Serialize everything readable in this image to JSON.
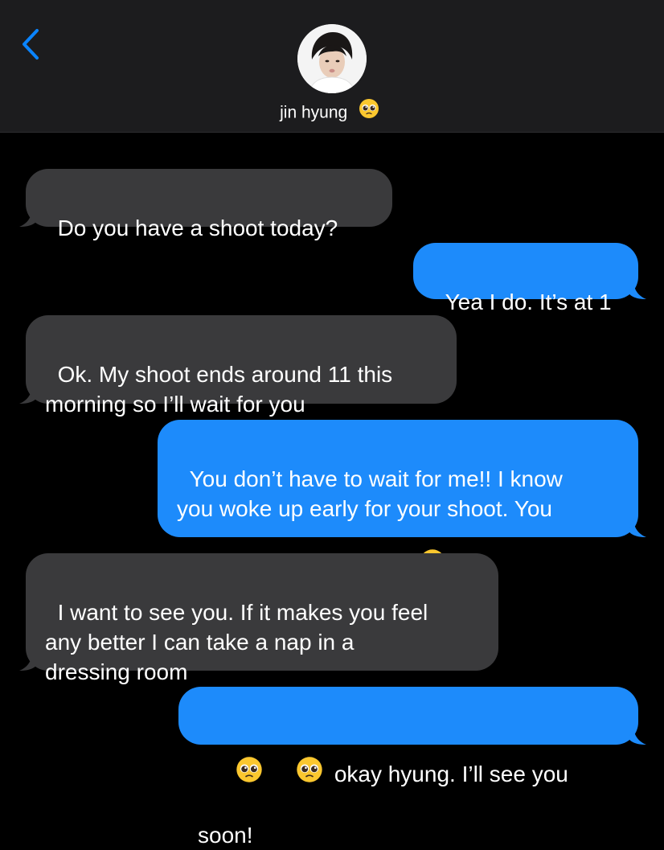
{
  "header": {
    "contact_name": "jin hyung",
    "contact_emoji": "pleading-face-emoji"
  },
  "messages": [
    {
      "direction": "incoming",
      "text": "Do you have a shoot today?"
    },
    {
      "direction": "outgoing",
      "text": "Yea I do. It’s at 1"
    },
    {
      "direction": "incoming",
      "text": "Ok. My shoot ends around 11 this\nmorning so I’ll wait for you"
    },
    {
      "direction": "outgoing",
      "text": "You don’t have to wait for me!! I know\nyou woke up early for your shoot. You\nshould go take a nap"
    },
    {
      "direction": "incoming",
      "text": "I want to see you. If it makes you feel\nany better I can take a nap in a\ndressing room"
    },
    {
      "direction": "outgoing",
      "text": "okay hyung. I’ll see you soon!"
    }
  ],
  "colors": {
    "background": "#000000",
    "header": "#1c1c1e",
    "incoming_bubble": "#3a3a3c",
    "outgoing_bubble": "#1d8bfb",
    "accent": "#0a84ff"
  }
}
